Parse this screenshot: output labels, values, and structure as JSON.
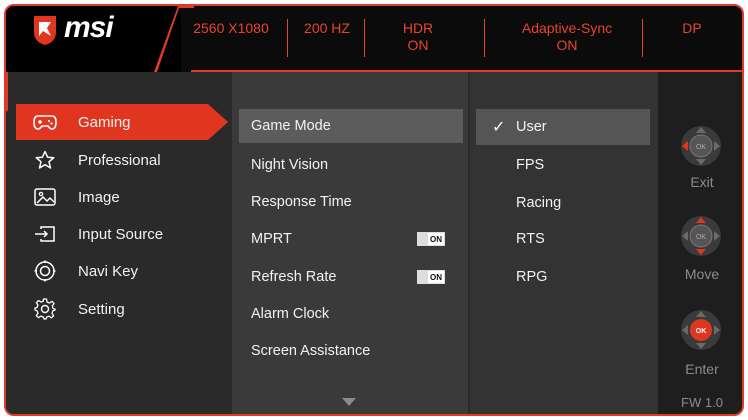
{
  "header": {
    "brand": "msi",
    "items": [
      {
        "line1": "2560 X1080",
        "line2": ""
      },
      {
        "line1": "200 HZ",
        "line2": ""
      },
      {
        "line1": "HDR",
        "line2": "ON"
      },
      {
        "line1": "Adaptive-Sync",
        "line2": "ON"
      },
      {
        "line1": "DP",
        "line2": ""
      }
    ]
  },
  "nav": {
    "items": [
      {
        "label": "Gaming",
        "icon": "gamepad-icon",
        "active": true
      },
      {
        "label": "Professional",
        "icon": "star-icon",
        "active": false
      },
      {
        "label": "Image",
        "icon": "image-icon",
        "active": false
      },
      {
        "label": "Input Source",
        "icon": "input-icon",
        "active": false
      },
      {
        "label": "Navi Key",
        "icon": "navi-key-icon",
        "active": false
      },
      {
        "label": "Setting",
        "icon": "gear-icon",
        "active": false
      }
    ]
  },
  "submenu": {
    "items": [
      {
        "label": "Game Mode",
        "active": true
      },
      {
        "label": "Night Vision"
      },
      {
        "label": "Response Time"
      },
      {
        "label": "MPRT",
        "toggle": "ON"
      },
      {
        "label": "Refresh Rate",
        "toggle": "ON"
      },
      {
        "label": "Alarm Clock"
      },
      {
        "label": "Screen Assistance"
      }
    ]
  },
  "options": {
    "items": [
      {
        "label": "User",
        "selected": true
      },
      {
        "label": "FPS"
      },
      {
        "label": "Racing"
      },
      {
        "label": "RTS"
      },
      {
        "label": "RPG"
      }
    ]
  },
  "controls": {
    "exit_label": "Exit",
    "move_label": "Move",
    "enter_label": "Enter",
    "ok_label": "OK",
    "firmware": "FW 1.0"
  },
  "colors": {
    "accent": "#e0361f",
    "header_text": "#e8442f",
    "panel_bg": "#2a2a2a"
  }
}
